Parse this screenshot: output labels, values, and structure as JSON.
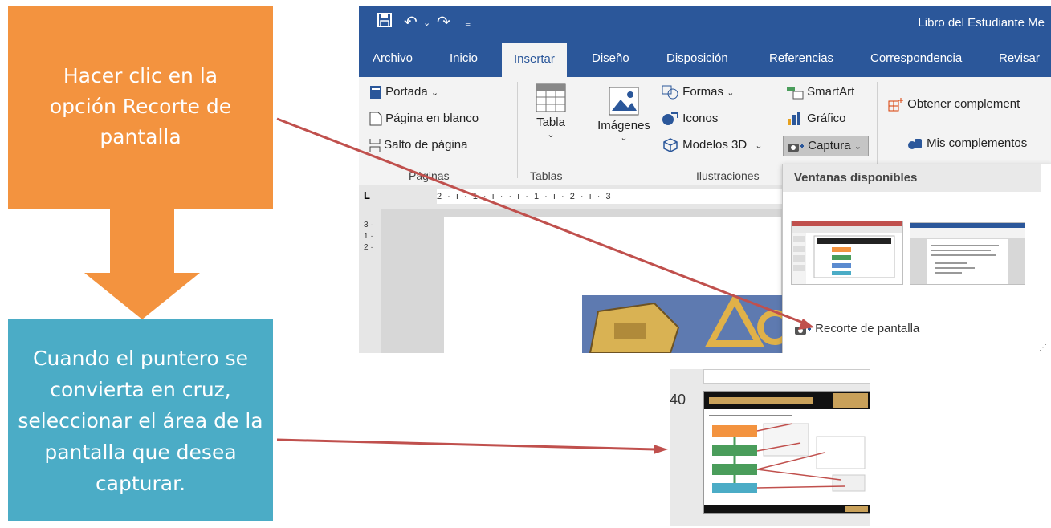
{
  "steps": {
    "step1": "Hacer clic en la opción Recorte de pantalla",
    "step2": "Cuando el puntero se convierta en cruz, seleccionar el área de la pantalla que desea capturar."
  },
  "word": {
    "title": "Libro del Estudiante Me",
    "tabs": [
      "Archivo",
      "Inicio",
      "Insertar",
      "Diseño",
      "Disposición",
      "Referencias",
      "Correspondencia",
      "Revisar"
    ],
    "active_tab": "Insertar",
    "ribbon": {
      "paginas": {
        "items": [
          "Portada",
          "Página en blanco",
          "Salto de página"
        ],
        "group": "Páginas"
      },
      "tablas": {
        "item": "Tabla",
        "group": "Tablas"
      },
      "ilustraciones": {
        "imagenes": "Imágenes",
        "formas": "Formas",
        "iconos": "Iconos",
        "modelos": "Modelos 3D",
        "smartart": "SmartArt",
        "grafico": "Gráfico",
        "captura": "Captura",
        "group": "Ilustraciones"
      },
      "complementos": {
        "obtener": "Obtener complement",
        "mis": "Mis complementos"
      }
    },
    "ruler": "2 · ı · 1 · ı ·  · ı · 1 · ı · 2 · ı · 3",
    "vruler": "3 · 1 · 2 ·",
    "dropdown": {
      "header": "Ventanas disponibles",
      "item": "Recorte de pantalla"
    }
  },
  "capture": {
    "page_number": "40"
  },
  "colors": {
    "orange": "#f3933f",
    "blue": "#4bacc6",
    "word_blue": "#2b579a",
    "arrow": "#c0504d"
  }
}
